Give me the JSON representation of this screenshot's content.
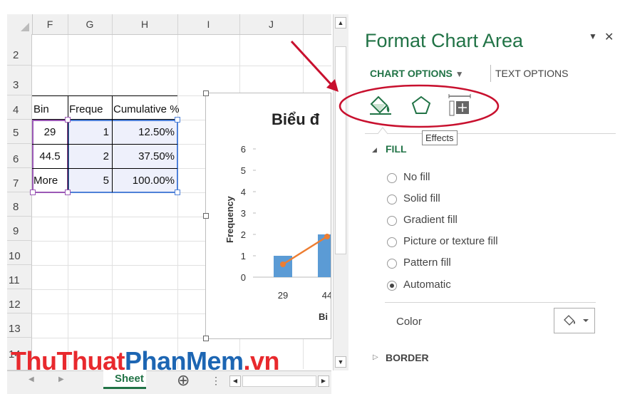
{
  "sheet": {
    "columns": [
      "F",
      "G",
      "H",
      "I",
      "J"
    ],
    "rows": [
      "2",
      "3",
      "4",
      "5",
      "6",
      "7",
      "8",
      "9",
      "10",
      "11",
      "12",
      "13",
      "14"
    ],
    "table": {
      "headers": [
        "Bin",
        "Freque",
        "Cumulative %"
      ],
      "rows": [
        [
          "29",
          "1",
          "12.50%"
        ],
        [
          "44.5",
          "2",
          "37.50%"
        ],
        [
          "More",
          "5",
          "100.00%"
        ]
      ]
    },
    "tab_label": "Sheet",
    "add_sheet": "⊕"
  },
  "chart": {
    "title": "Biểu đ",
    "ylabel": "Frequency",
    "xlabel": "Bi",
    "chart_data": {
      "type": "bar",
      "categories": [
        "29",
        "44"
      ],
      "values": [
        1,
        2
      ],
      "line_values": [
        0.6,
        1.9
      ],
      "ylim": [
        0,
        6
      ],
      "yticks": [
        "0",
        "1",
        "2",
        "3",
        "4",
        "5",
        "6"
      ]
    },
    "colors": {
      "bar": "#5b9bd5",
      "line": "#ed7d31"
    }
  },
  "pane": {
    "title": "Format Chart Area",
    "dropdown_glyph": "▼",
    "close_glyph": "✕",
    "chart_options": "CHART OPTIONS",
    "text_options": "TEXT OPTIONS",
    "tooltip": "Effects",
    "fill_header": "FILL",
    "fill_options": [
      {
        "label": "No fill",
        "selected": false
      },
      {
        "label": "Solid fill",
        "selected": false
      },
      {
        "label": "Gradient fill",
        "selected": false
      },
      {
        "label": "Picture or texture fill",
        "selected": false
      },
      {
        "label": "Pattern fill",
        "selected": false
      },
      {
        "label": "Automatic",
        "selected": true
      }
    ],
    "color_label": "Color",
    "border_header": "BORDER"
  },
  "watermark": {
    "part1": "ThuThuat",
    "part2": "PhanMem",
    "part3": ".vn"
  },
  "colors": {
    "accent": "#217346",
    "annotation": "#c8102e",
    "selection": "#7a6fd6"
  }
}
